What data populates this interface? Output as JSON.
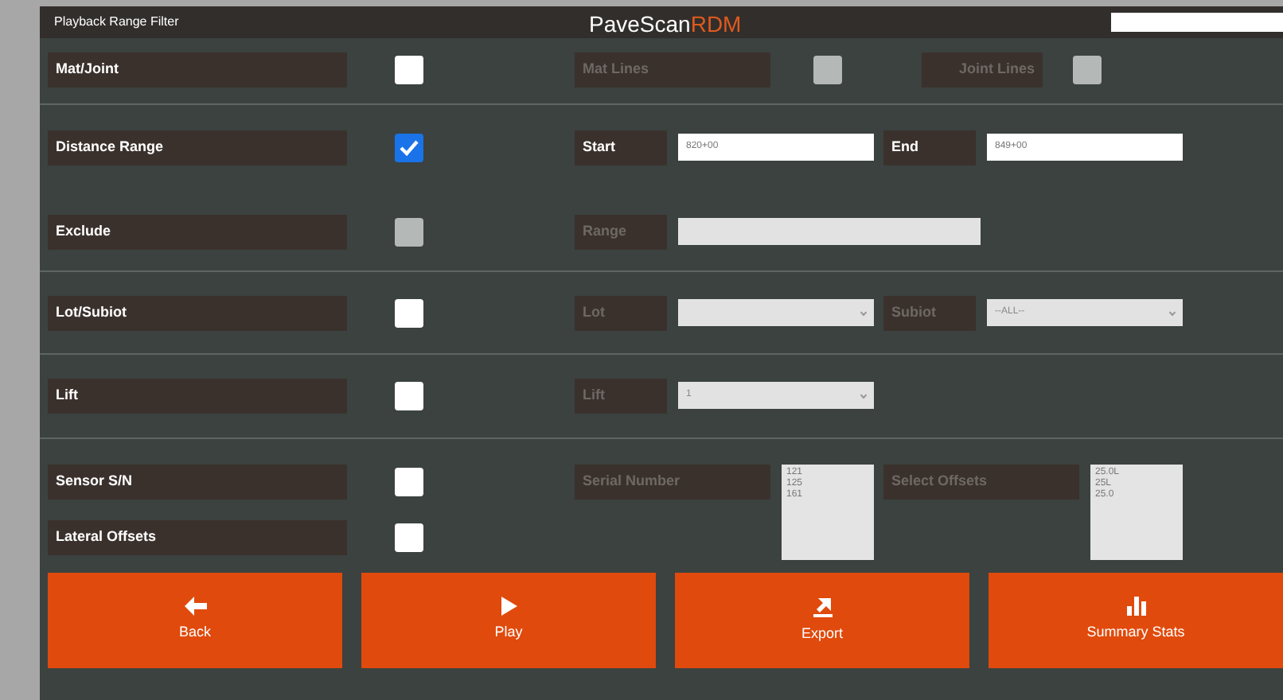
{
  "window": {
    "title": "Playback Range Filter",
    "brand": "PaveScan",
    "brand_accent": "RDM"
  },
  "sections": [
    {
      "rows": [
        {
          "label": "Mat/Joint",
          "checked": false,
          "disabled": false
        }
      ],
      "controls": [
        {
          "kind": "checkbox",
          "label": "Mat Lines",
          "checked": false,
          "disabled": true
        },
        {
          "kind": "checkbox",
          "label": "Joint Lines",
          "checked": false,
          "disabled": true
        }
      ]
    },
    {
      "rows": [
        {
          "label": "Distance Range",
          "checked": true,
          "disabled": false
        },
        {
          "label": "Exclude",
          "checked": false,
          "disabled": true
        }
      ],
      "controls": [
        {
          "kind": "text",
          "label": "Start",
          "value": "820+00",
          "disabled": false
        },
        {
          "kind": "text",
          "label": "End",
          "value": "849+00",
          "disabled": false
        },
        {
          "kind": "wide-text",
          "label": "Range",
          "disabled": true
        }
      ]
    },
    {
      "rows": [
        {
          "label": "Lot/Subiot",
          "checked": false,
          "disabled": false
        }
      ],
      "controls": [
        {
          "kind": "select",
          "label": "Lot",
          "disabled": true
        },
        {
          "kind": "select",
          "label": "Subiot",
          "value": "--ALL--",
          "disabled": true
        }
      ]
    },
    {
      "rows": [
        {
          "label": "Lift",
          "checked": false,
          "disabled": false
        }
      ],
      "controls": [
        {
          "kind": "select",
          "label": "Lift",
          "value": "1",
          "disabled": true
        }
      ]
    },
    {
      "rows": [
        {
          "label": "Sensor S/N",
          "checked": false,
          "disabled": false
        },
        {
          "label": "Lateral Offsets",
          "checked": false,
          "disabled": false
        }
      ],
      "controls": [
        {
          "kind": "listbox",
          "label": "Serial Number",
          "items": [
            "121",
            "125",
            "161"
          ],
          "disabled": true
        },
        {
          "kind": "listbox",
          "label": "Select Offsets",
          "items": [
            "25.0L",
            "25L",
            "25.0"
          ],
          "disabled": true
        }
      ]
    }
  ],
  "buttons": [
    {
      "kind": "back",
      "label": "Back"
    },
    {
      "kind": "play",
      "label": "Play"
    },
    {
      "kind": "export",
      "label": "Export"
    },
    {
      "kind": "stats",
      "label": "Summary Stats"
    }
  ]
}
